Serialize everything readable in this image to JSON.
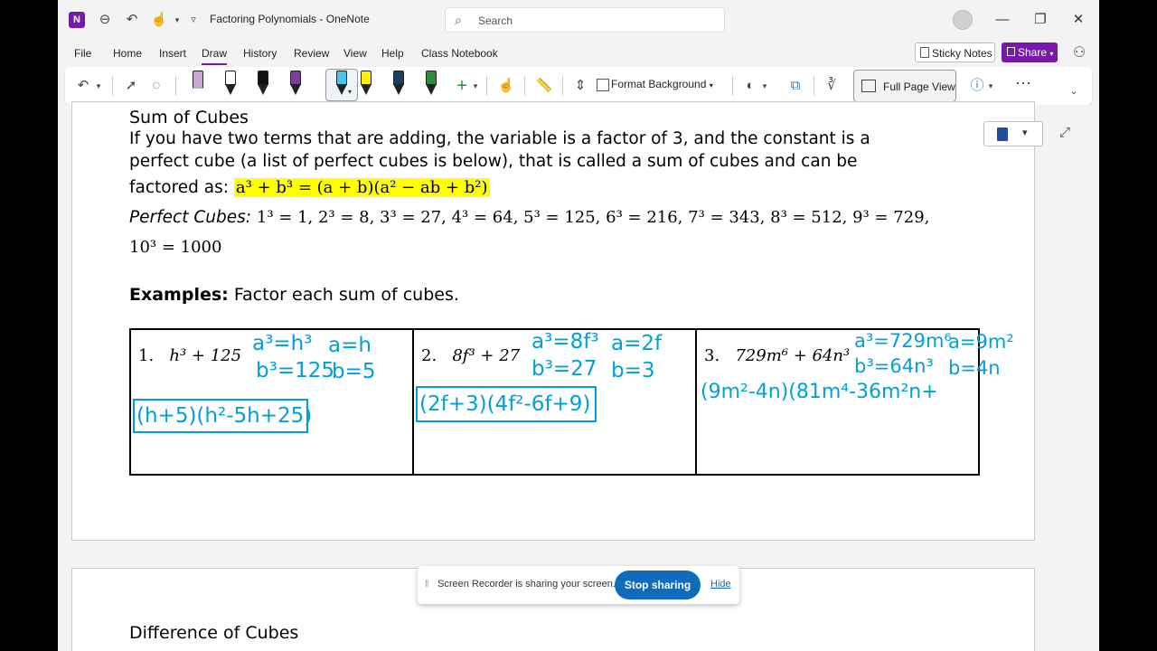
{
  "titlebar": {
    "title": "Factoring Polynomials",
    "separator": "-",
    "app": "OneNote",
    "search_placeholder": "Search",
    "logo_letter": "N"
  },
  "menu": [
    "File",
    "Home",
    "Insert",
    "Draw",
    "History",
    "Review",
    "View",
    "Help",
    "Class Notebook"
  ],
  "menu_active": "Draw",
  "right_buttons": {
    "sticky_notes": "Sticky Notes",
    "share": "Share"
  },
  "ribbon": {
    "format_background": "Format Background",
    "full_page_view": "Full Page View",
    "pen_colors": [
      "#c9a7d6",
      "#ffffff",
      "#111111",
      "#7a3f9d",
      "#49c6ea",
      "#ffef00",
      "#1f3b66",
      "#2f8a3a"
    ]
  },
  "page": {
    "section_title": "Sum of Cubes",
    "line1": "If you have two terms that are adding, the variable is a factor of 3, and the constant is a",
    "line2": "perfect cube (a list of perfect cubes is below), that is called a sum of cubes and can be",
    "line3_prefix": "factored as:",
    "formula": "a³ + b³ = (a + b)(a² − ab + b²)",
    "perfect_cubes_label": "Perfect Cubes:",
    "perfect_cubes": "1³ = 1, 2³ = 8, 3³ = 27, 4³ = 64, 5³ = 125, 6³ = 216, 7³ = 343, 8³ = 512, 9³ = 729,",
    "perfect_cubes_end": "10³ = 1000",
    "examples_label": "Examples:",
    "examples_text": "Factor each sum of cubes.",
    "problems": [
      {
        "number": "1.",
        "expr": "h³ + 125",
        "notes": [
          "a³=h³",
          "a=h",
          "b³=125",
          "b=5"
        ],
        "answer": "(h+5)(h²-5h+25)"
      },
      {
        "number": "2.",
        "expr": "8f³ + 27",
        "notes": [
          "a³=8f³",
          "a=2f",
          "b³=27",
          "b=3"
        ],
        "answer": "(2f+3)(4f²-6f+9)"
      },
      {
        "number": "3.",
        "expr": "729m⁶ + 64n³",
        "notes": [
          "a³=729m⁶",
          "a=9m²",
          "b³=64n³",
          "b=4n"
        ],
        "answer": "(9m²-4n)(81m⁴-36m²n+"
      }
    ],
    "next_section_title": "Difference of Cubes"
  },
  "sharebar": {
    "message": "Screen Recorder is sharing your screen.",
    "stop": "Stop sharing",
    "hide": "Hide"
  },
  "colors": {
    "accent": "#7719aa",
    "ink_blue": "#00a0d8",
    "highlight": "#ffff00",
    "stop_button": "#0f6cbd"
  }
}
